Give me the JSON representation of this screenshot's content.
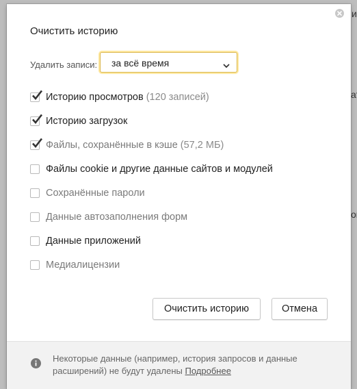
{
  "dialog": {
    "title": "Очистить историю",
    "period_label": "Удалить записи:",
    "period_value": "за всё время",
    "options": [
      {
        "label": "Историю просмотров",
        "extra": " (120 записей)",
        "checked": true
      },
      {
        "label": "Историю загрузок",
        "extra": "",
        "checked": true
      },
      {
        "label": "Файлы, сохранённые в кэше",
        "extra": " (57,2 МБ)",
        "checked": true,
        "muted": true
      },
      {
        "label": "Файлы cookie и другие данные сайтов и модулей",
        "extra": "",
        "checked": false
      },
      {
        "label": "Сохранённые пароли",
        "extra": "",
        "checked": false,
        "muted": true
      },
      {
        "label": "Данные автозаполнения форм",
        "extra": "",
        "checked": false,
        "muted": true
      },
      {
        "label": "Данные приложений",
        "extra": "",
        "checked": false
      },
      {
        "label": "Медиалицензии",
        "extra": "",
        "checked": false,
        "muted": true
      }
    ],
    "clear_button": "Очистить историю",
    "cancel_button": "Отмена",
    "footer_text": "Некоторые данные (например, история запросов и данные расширений) не будут удалены",
    "footer_link": "Подробнее"
  },
  "background": {
    "frag1": "и",
    "frag2": "ат",
    "frag3": "ощ"
  },
  "colors": {
    "checkmark": "#333333",
    "select_border": "#d9b54a",
    "select_glow": "#ffe9a3",
    "footer_bg": "#f2f2f2"
  },
  "icons": {
    "close": "close-circle-icon",
    "chevron": "chevron-down-icon",
    "check": "checkmark-icon",
    "info": "info-circle-icon"
  }
}
